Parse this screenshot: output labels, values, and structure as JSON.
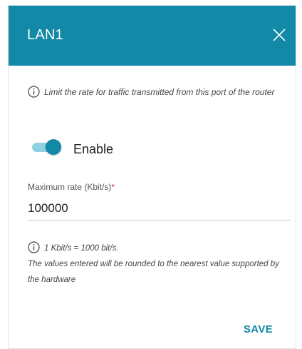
{
  "dialog": {
    "title": "LAN1",
    "close_icon": "close-icon",
    "header_color": "#1189a7",
    "accent_color": "#1189a7"
  },
  "info": {
    "icon": "info-icon",
    "text": "Limit the rate for traffic transmitted from this port of the router"
  },
  "toggle": {
    "label": "Enable",
    "state": true
  },
  "rate_field": {
    "label": "Maximum rate (Kbit/s)",
    "required_mark": "*",
    "value": "100000"
  },
  "note": {
    "icon": "info-icon",
    "line1": "1 Kbit/s = 1000 bit/s.",
    "line2": "The values entered will be rounded to the nearest value supported by the hardware"
  },
  "actions": {
    "save_label": "SAVE"
  }
}
